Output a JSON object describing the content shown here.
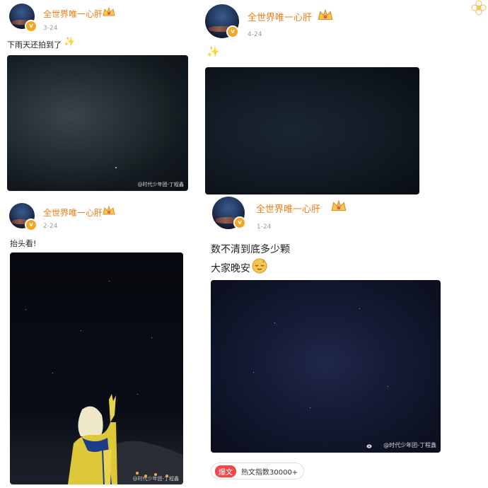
{
  "posts": [
    {
      "username": "全世界唯一心肝",
      "date": "3-24",
      "text": "下雨天还拍到了",
      "watermark": "@时代少年团-丁程鑫"
    },
    {
      "username": "全世界唯一心肝",
      "date": "4-24",
      "text": "",
      "watermark": ""
    },
    {
      "username": "全世界唯一心肝",
      "date": "2-24",
      "text": "抬头看!",
      "watermark": "@时代少年团-丁程鑫"
    },
    {
      "username": "全世界唯一心肝",
      "date": "1-24",
      "text_line1": "数不清到底多少颗",
      "text_line2": "大家晚安",
      "watermark": "@时代少年团-丁程鑫"
    }
  ],
  "hot_tag": {
    "pill": "爆文",
    "index_text": "热文指数30000+"
  },
  "icons": {
    "verified": "verified-v-icon",
    "crown": "crown-badge-icon",
    "sparkle": "sparkle-emoji-icon",
    "sleepy": "sleepy-face-emoji-icon",
    "weibo": "weibo-logo-icon"
  },
  "colors": {
    "username": "#f57c14",
    "badge": "#f5a623",
    "hot_pill": "#f04848"
  }
}
